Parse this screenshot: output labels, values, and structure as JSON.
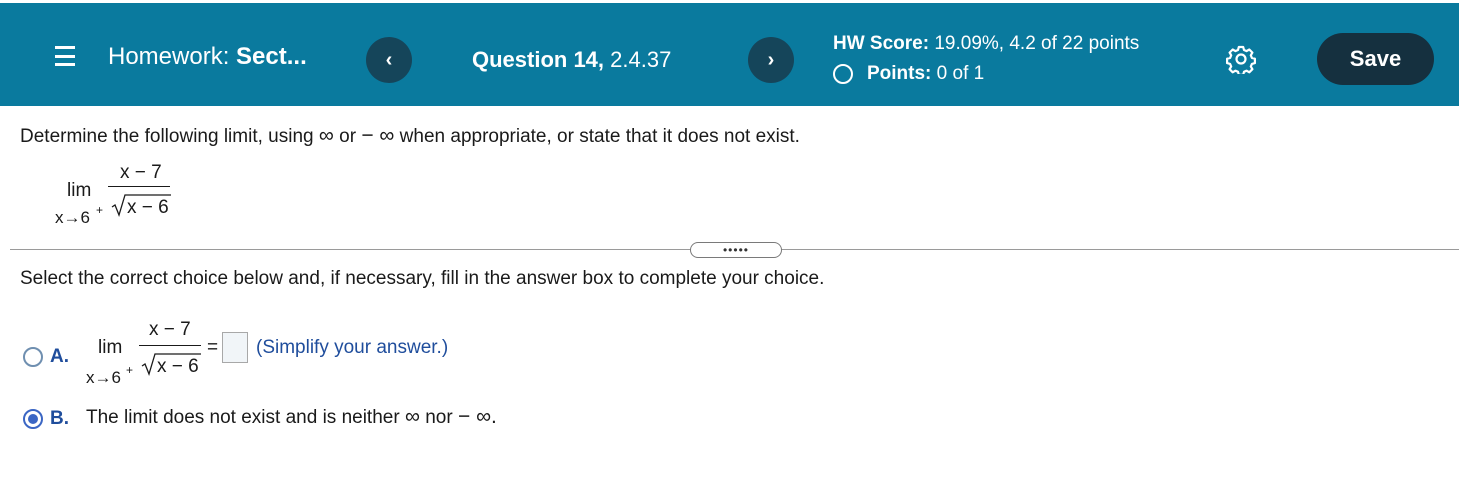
{
  "header": {
    "title_prefix": "Homework:",
    "title_section": "Sect...",
    "prev_label": "‹",
    "next_label": "›",
    "question_label": "Question 14,",
    "question_id": "2.4.37",
    "score_label": "HW Score:",
    "score_value": "19.09%, 4.2 of 22 points",
    "points_label": "Points:",
    "points_value": "0 of 1",
    "save_label": "Save",
    "settings_icon": "gear-icon"
  },
  "problem": {
    "instruction_1": "Determine the following limit, using",
    "inf": "∞",
    "or": "or",
    "neg_inf": "− ∞",
    "instruction_2": "when appropriate, or state that it does not exist.",
    "lim": "lim",
    "numerator": "x − 7",
    "denominator": "x − 6",
    "subscript": "x→6",
    "superscript": "+"
  },
  "divider": {
    "expand_label": "•••••"
  },
  "prompt": "Select the correct choice below and, if necessary, fill in the answer box to complete your choice.",
  "choices": [
    {
      "letter": "A.",
      "lim": "lim",
      "numerator": "x − 7",
      "denominator": "x − 6",
      "subscript": "x→6",
      "superscript": "+",
      "equals": "=",
      "answer_value": "",
      "hint": "(Simplify your answer.)",
      "selected": false
    },
    {
      "letter": "B.",
      "text_1": "The limit does not exist and is neither",
      "inf": "∞",
      "nor": "nor",
      "neg_inf": "− ∞.",
      "selected": true
    }
  ],
  "colors": {
    "header_bg": "#0a7a9e",
    "nav_btn_bg": "#15455a",
    "save_btn_bg": "#15303f",
    "choice_accent": "#1f4d9c",
    "radio_selected": "#3b66c4"
  }
}
